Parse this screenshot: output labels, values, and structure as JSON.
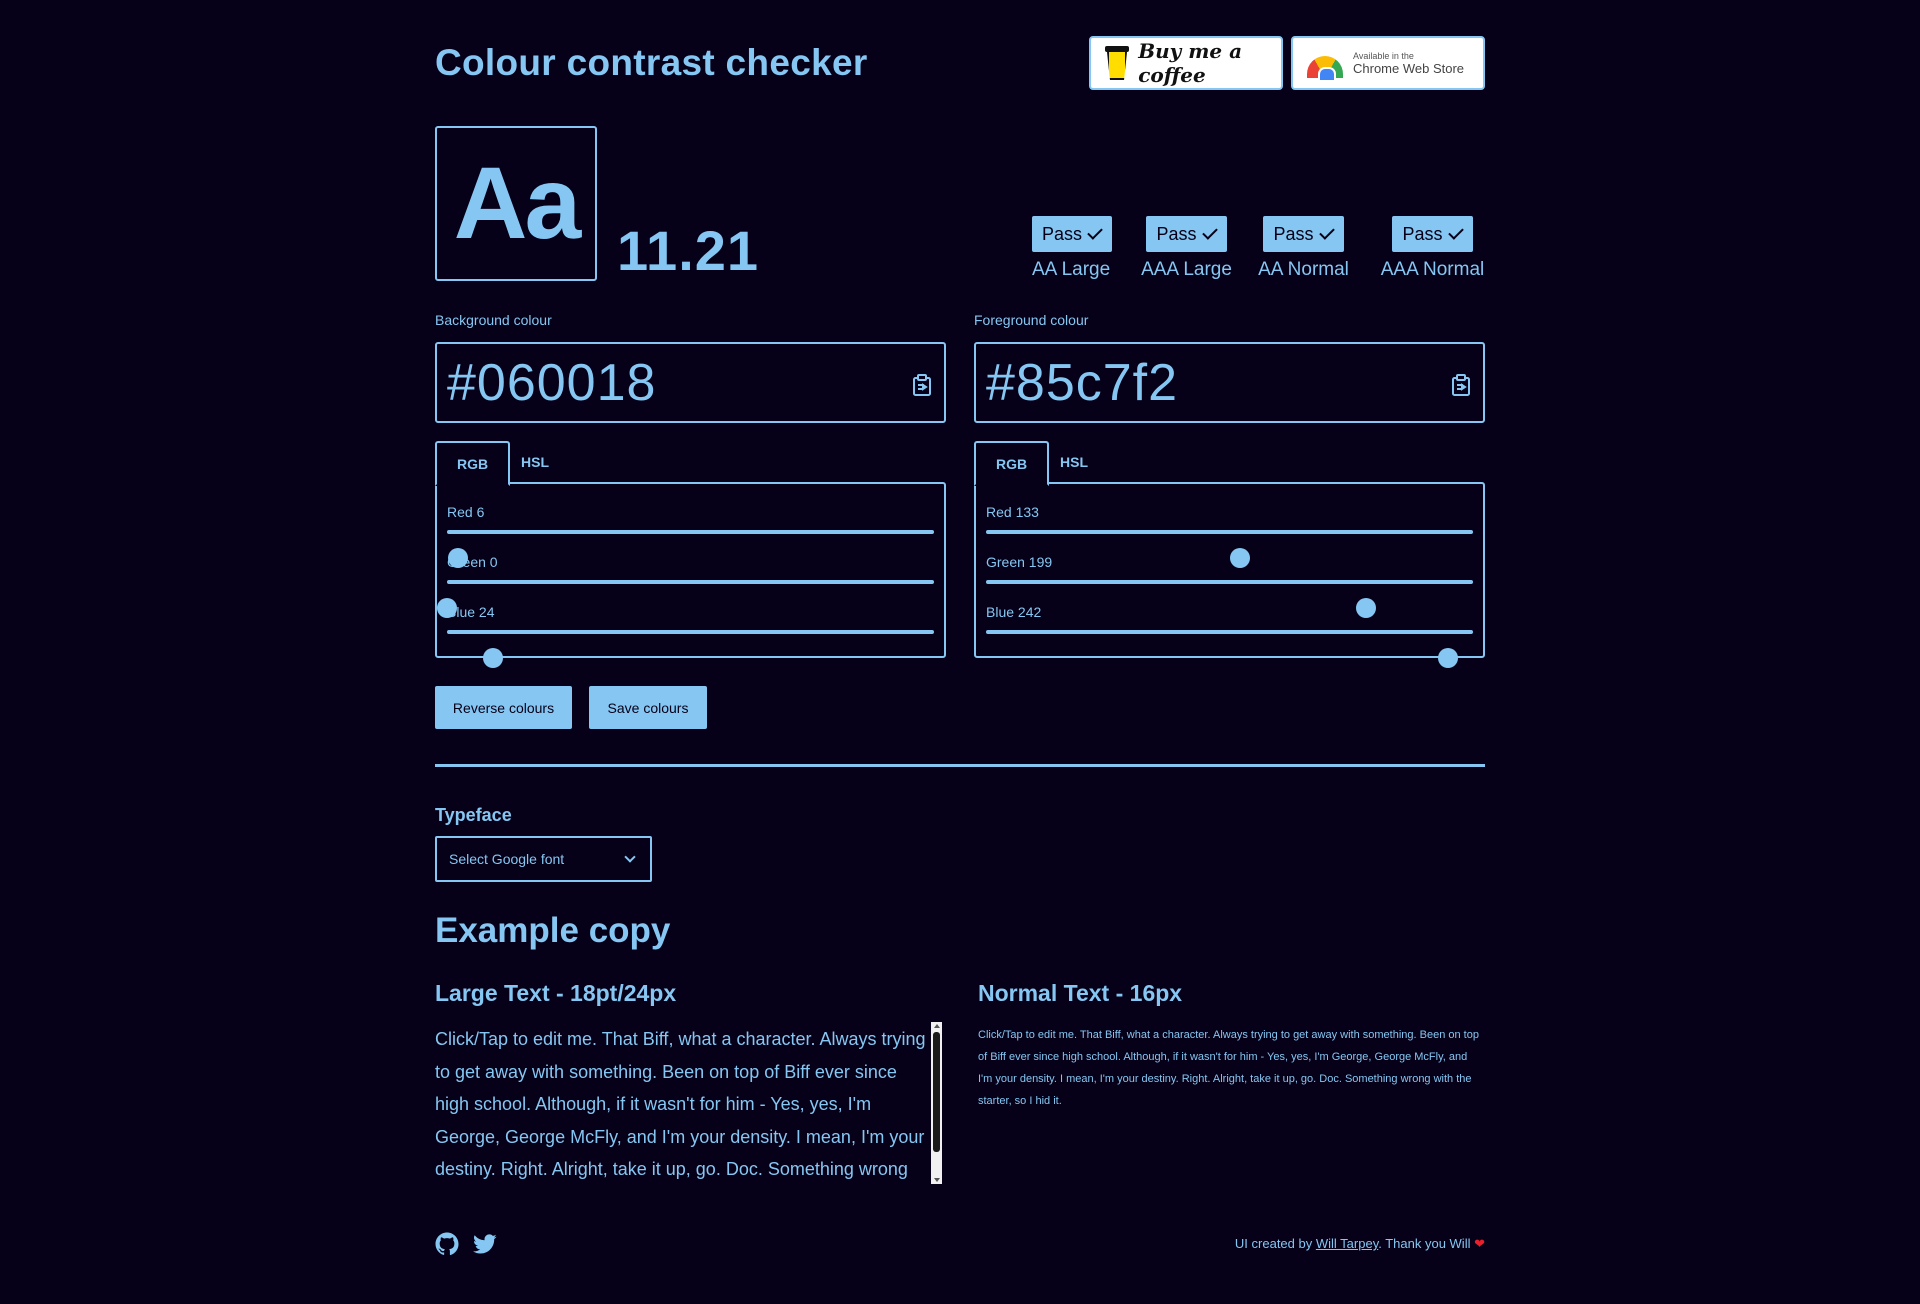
{
  "header": {
    "title": "Colour contrast checker",
    "coffee_label": "Buy me a coffee",
    "chrome_small": "Available in the",
    "chrome_big": "Chrome Web Store"
  },
  "preview": {
    "sample": "Aa",
    "ratio": "11.21"
  },
  "results": [
    {
      "status": "Pass",
      "label": "AA Large"
    },
    {
      "status": "Pass",
      "label": "AAA Large"
    },
    {
      "status": "Pass",
      "label": "AA Normal"
    },
    {
      "status": "Pass",
      "label": "AAA Normal"
    }
  ],
  "background": {
    "label": "Background colour",
    "hex": "#060018",
    "tabs": [
      "RGB",
      "HSL"
    ],
    "active_tab": "RGB",
    "sliders": [
      {
        "label": "Red 6",
        "value": 6,
        "max": 255
      },
      {
        "label": "Green 0",
        "value": 0,
        "max": 255
      },
      {
        "label": "Blue 24",
        "value": 24,
        "max": 255
      }
    ]
  },
  "foreground": {
    "label": "Foreground colour",
    "hex": "#85c7f2",
    "tabs": [
      "RGB",
      "HSL"
    ],
    "active_tab": "RGB",
    "sliders": [
      {
        "label": "Red 133",
        "value": 133,
        "max": 255
      },
      {
        "label": "Green 199",
        "value": 199,
        "max": 255
      },
      {
        "label": "Blue 242",
        "value": 242,
        "max": 255
      }
    ]
  },
  "actions": {
    "reverse": "Reverse colours",
    "save": "Save colours"
  },
  "typeface": {
    "label": "Typeface",
    "select_value": "Select Google font"
  },
  "example": {
    "title": "Example copy",
    "large_title": "Large Text - 18pt/24px",
    "normal_title": "Normal Text - 16px",
    "large_copy": "Click/Tap to edit me. That Biff, what a character. Always trying to get away with something. Been on top of Biff ever since high school. Although, if it wasn't for him - Yes, yes, I'm George, George McFly, and I'm your density. I mean, I'm your destiny. Right. Alright, take it up, go. Doc. Something wrong with the starter, so I hid it.",
    "normal_copy": "Click/Tap to edit me. That Biff, what a character. Always trying to get away with something. Been on top of Biff ever since high school. Although, if it wasn't for him - Yes, yes, I'm George, George McFly, and I'm your density. I mean, I'm your destiny. Right. Alright, take it up, go. Doc. Something wrong with the starter, so I hid it."
  },
  "footer": {
    "credit_prefix": "UI created by ",
    "credit_link": "Will Tarpey",
    "credit_suffix": ". Thank you Will ",
    "heart": "❤"
  },
  "colors": {
    "background": "#060018",
    "accent": "#85c7f2",
    "heart": "#e8202b"
  }
}
